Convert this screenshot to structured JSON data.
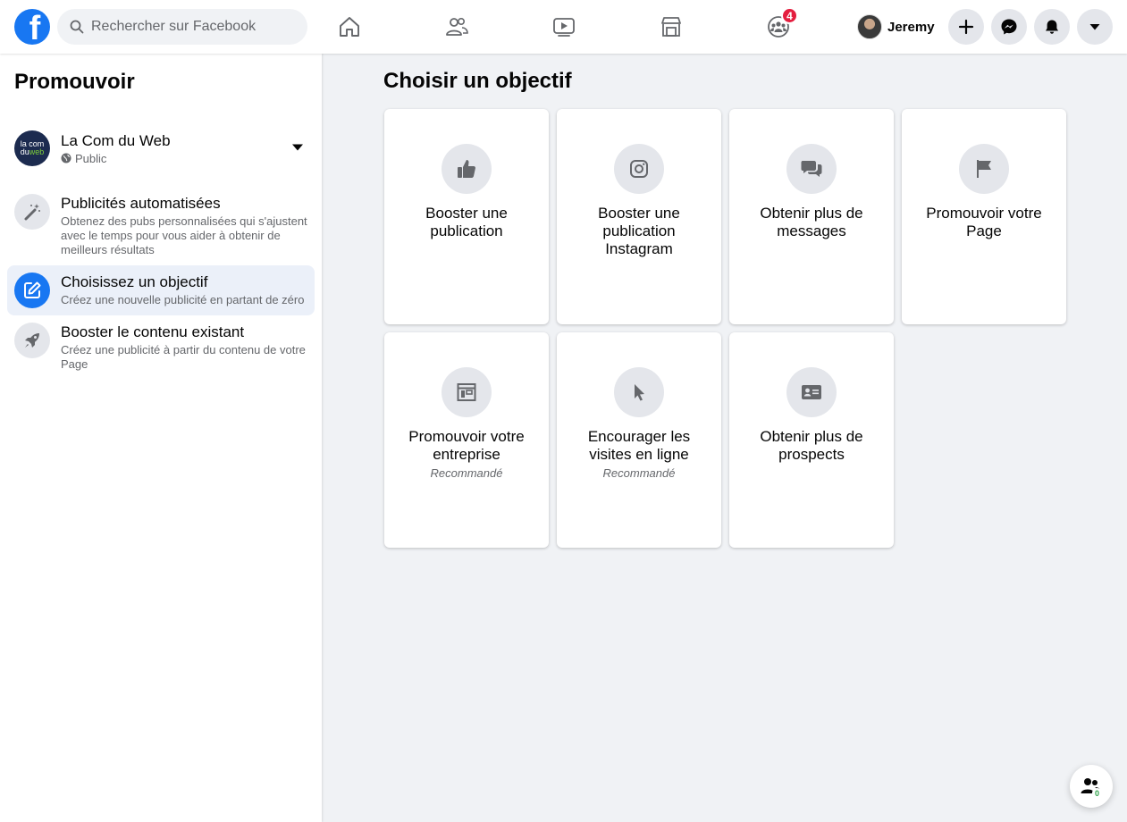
{
  "header": {
    "search_placeholder": "Rechercher sur Facebook",
    "groups_badge": "4",
    "profile_name": "Jeremy"
  },
  "sidebar": {
    "title": "Promouvoir",
    "page": {
      "name": "La Com du Web",
      "visibility": "Public",
      "logo_line1": "la com",
      "logo_line2": "du",
      "logo_line3": "web"
    },
    "items": [
      {
        "title": "Publicités automatisées",
        "desc": "Obtenez des pubs personnalisées qui s'ajustent avec le temps pour vous aider à obtenir de meilleurs résultats"
      },
      {
        "title": "Choisissez un objectif",
        "desc": "Créez une nouvelle publicité en partant de zéro"
      },
      {
        "title": "Booster le contenu existant",
        "desc": "Créez une publicité à partir du contenu de votre Page"
      }
    ]
  },
  "main": {
    "title": "Choisir un objectif",
    "cards": [
      {
        "label": "Booster une publication",
        "icon": "thumbs-up-icon"
      },
      {
        "label": "Booster une publication Instagram",
        "icon": "instagram-icon"
      },
      {
        "label": "Obtenir plus de messages",
        "icon": "chat-bubbles-icon"
      },
      {
        "label": "Promouvoir votre Page",
        "icon": "flag-icon"
      },
      {
        "label": "Promouvoir votre entreprise",
        "sub": "Recommandé",
        "icon": "storefront-window-icon"
      },
      {
        "label": "Encourager les visites en ligne",
        "sub": "Recommandé",
        "icon": "cursor-icon"
      },
      {
        "label": "Obtenir plus de prospects",
        "icon": "id-card-icon"
      }
    ]
  },
  "contacts": {
    "count": "0"
  },
  "colors": {
    "brand": "#1877f2",
    "badge": "#e41e3f",
    "active_bg": "#ebf0f9"
  }
}
